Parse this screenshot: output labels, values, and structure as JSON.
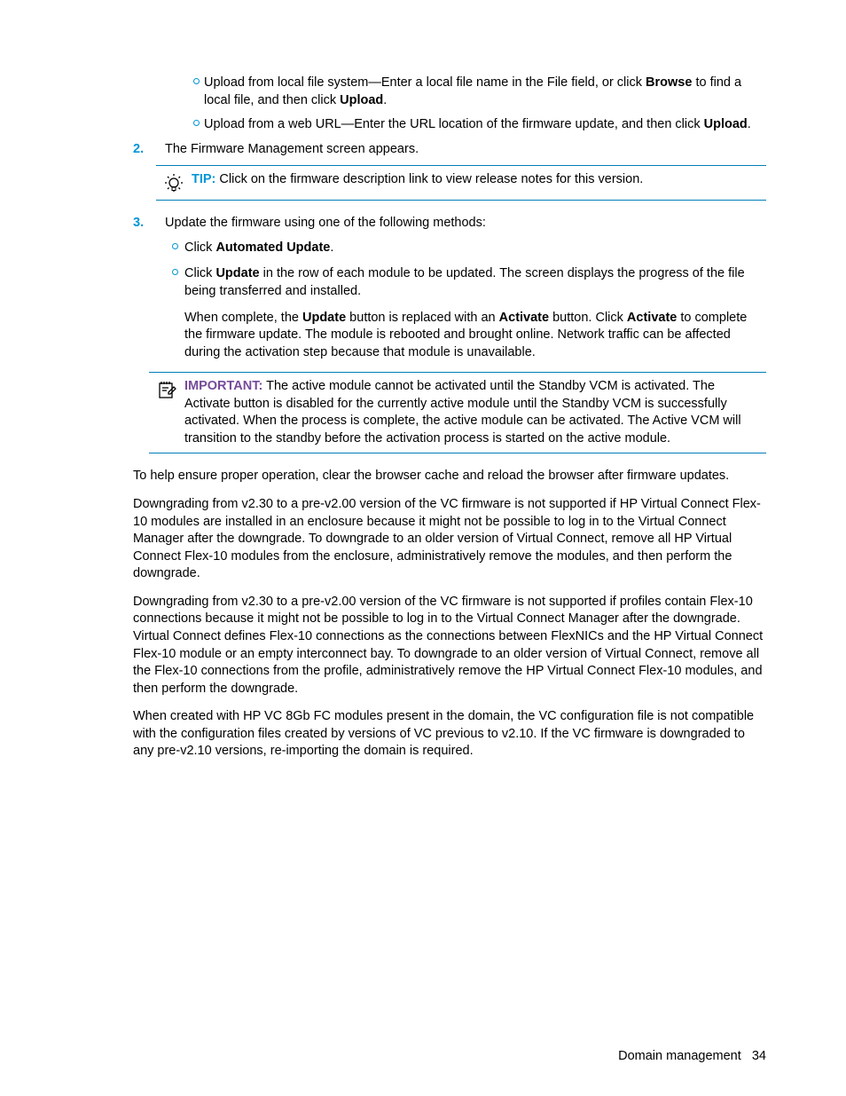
{
  "bullets": {
    "b1_pre": "Upload from local file system—Enter a local file name in the File field, or click ",
    "b1_bold1": "Browse",
    "b1_mid": " to find a local file, and then click ",
    "b1_bold2": "Upload",
    "b1_end": ".",
    "b2_pre": "Upload from a web URL—Enter the URL location of the firmware update, and then click ",
    "b2_bold": "Upload",
    "b2_end": "."
  },
  "step2": {
    "num": "2.",
    "text": "The Firmware Management screen appears."
  },
  "tip": {
    "label": "TIP:",
    "text": "  Click on the firmware description link to view release notes for this version."
  },
  "step3": {
    "num": "3.",
    "intro": "Update the firmware using one of the following methods:",
    "s1_pre": "Click ",
    "s1_bold": "Automated Update",
    "s1_end": ".",
    "s2_pre": "Click ",
    "s2_bold": "Update",
    "s2_rest": " in the row of each module to be updated. The screen displays the progress of the file being transferred and installed.",
    "cont_pre": "When complete, the ",
    "cont_b1": "Update",
    "cont_mid1": " button is replaced with an ",
    "cont_b2": "Activate",
    "cont_mid2": " button. Click ",
    "cont_b3": "Activate",
    "cont_end": " to complete the firmware update. The module is rebooted and brought online. Network traffic can be affected during the activation step because that module is unavailable."
  },
  "important": {
    "label": "IMPORTANT:",
    "text": "  The active module cannot be activated until the Standby VCM is activated. The Activate button is disabled for the currently active module until the Standby VCM is successfully activated. When the process is complete, the active module can be activated. The Active VCM will transition to the standby before the activation process is started on the active module."
  },
  "p1": "To help ensure proper operation, clear the browser cache and reload the browser after firmware updates.",
  "p2": "Downgrading from v2.30 to a pre-v2.00 version of the VC firmware is not supported if HP Virtual Connect Flex-10 modules are installed in an enclosure because it might not be possible to log in to the Virtual Connect Manager after the downgrade. To downgrade to an older version of Virtual Connect, remove all HP Virtual Connect Flex-10 modules from the enclosure, administratively remove the modules, and then perform the downgrade.",
  "p3": "Downgrading from v2.30 to a pre-v2.00 version of the VC firmware is not supported if profiles contain Flex-10 connections because it might not be possible to log in to the Virtual Connect Manager after the downgrade. Virtual Connect defines Flex-10 connections as the connections between FlexNICs and the HP Virtual Connect Flex-10 module or an empty interconnect bay. To downgrade to an older version of Virtual Connect, remove all the Flex-10 connections from the profile, administratively remove the HP Virtual Connect Flex-10 modules, and then perform the downgrade.",
  "p4": "When created with HP VC 8Gb FC modules present in the domain, the VC configuration file is not compatible with the configuration files created by versions of VC previous to v2.10. If the VC firmware is downgraded to any pre-v2.10 versions, re-importing the domain is required.",
  "footer": {
    "section": "Domain management",
    "page": "34"
  }
}
